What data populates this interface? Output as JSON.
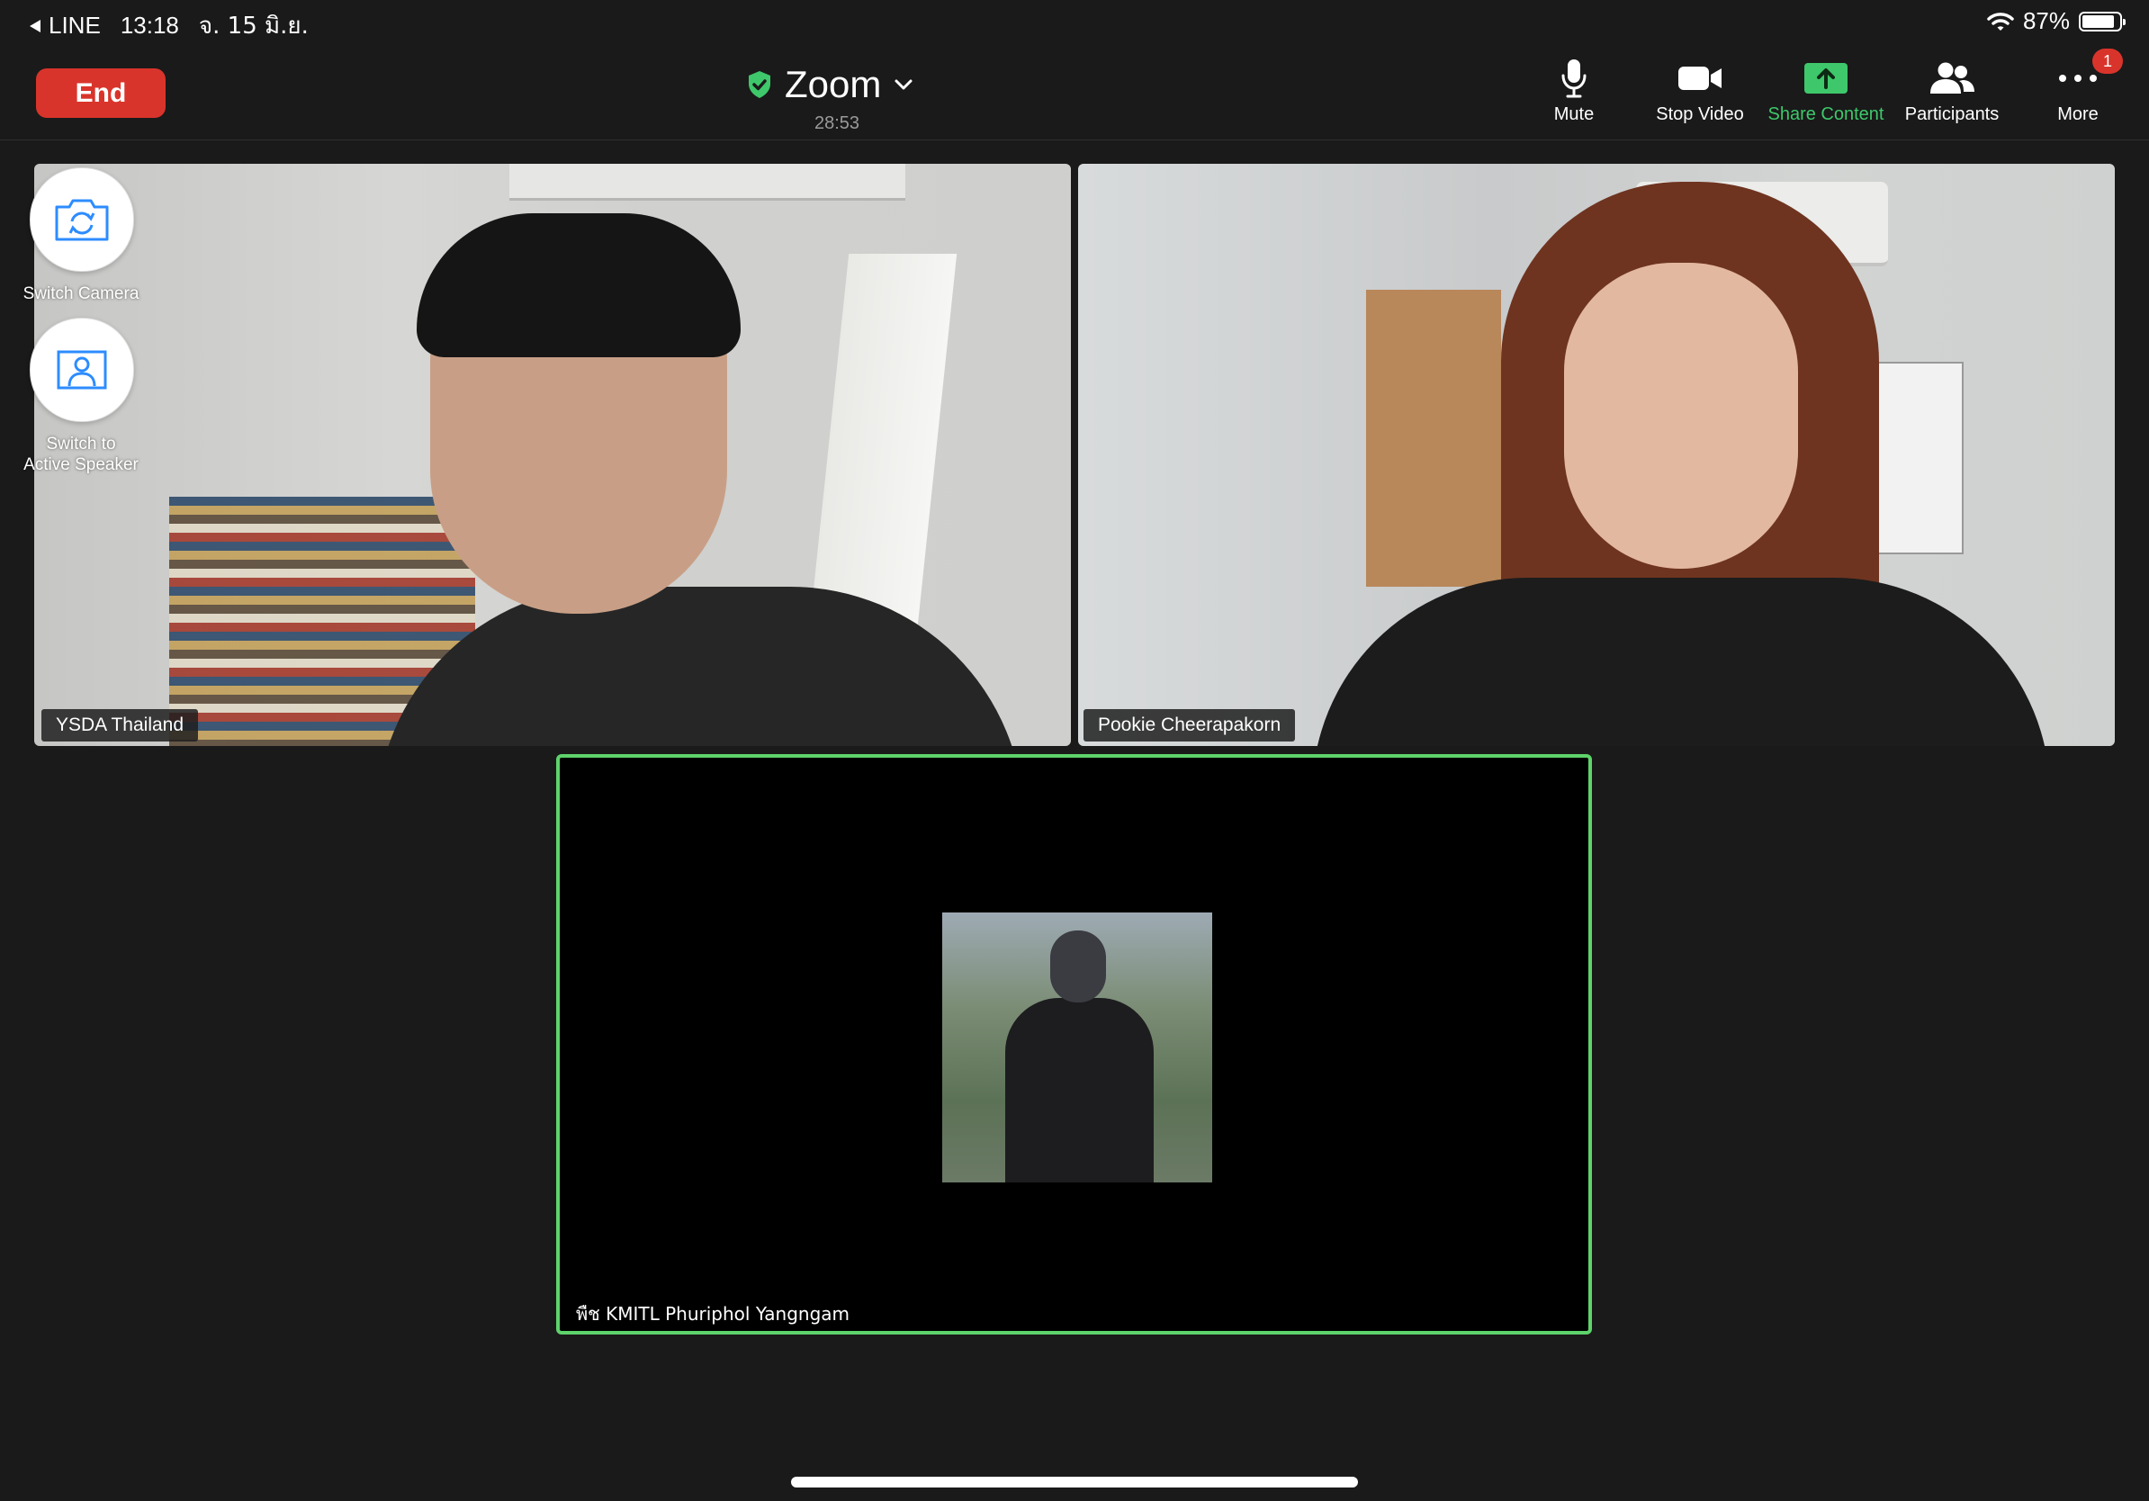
{
  "status_bar": {
    "back_app": "LINE",
    "time": "13:18",
    "date": "จ. 15 มิ.ย.",
    "battery_percent": "87%",
    "battery_level": 0.87
  },
  "toolbar": {
    "end_label": "End",
    "meeting_title": "Zoom",
    "timer": "28:53",
    "mute_label": "Mute",
    "stop_video_label": "Stop Video",
    "share_label": "Share Content",
    "participants_label": "Participants",
    "more_label": "More",
    "more_badge": "1",
    "accent_green": "#3ec86b",
    "end_color": "#d9342b"
  },
  "overlay": {
    "switch_camera_label": "Switch Camera",
    "active_speaker_line1": "Switch to",
    "active_speaker_line2": "Active Speaker"
  },
  "participants": [
    {
      "name": "YSDA Thailand"
    },
    {
      "name": "Pookie Cheerapakorn"
    },
    {
      "name": "พืช KMITL Phuriphol Yangngam",
      "active_speaker": true
    }
  ]
}
